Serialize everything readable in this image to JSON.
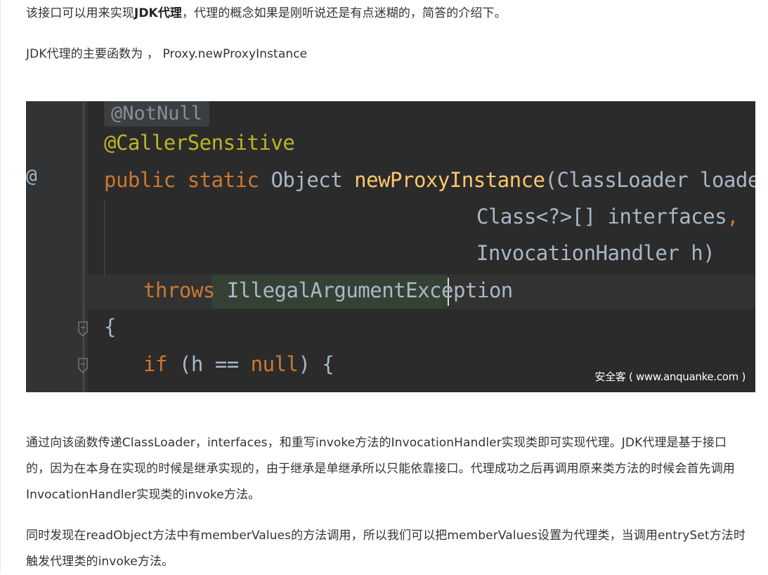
{
  "intro": {
    "line1_before": "该接口可以用来实现",
    "line1_bold": "JDK代理",
    "line1_after": "，代理的概念如果是刚听说还是有点迷糊的，简答的介绍下。",
    "line2": "JDK代理的主要函数为 ， Proxy.newProxyInstance"
  },
  "code": {
    "annotation_hint": "@NotNull",
    "gutter_marker": "@",
    "line1": "@CallerSensitive",
    "line2_kw": "public static ",
    "line2_type": "Object ",
    "line2_fn": "newProxyInstance",
    "line2_args": "(ClassLoader loader",
    "comma": ",",
    "line3": "Class<?>[] interfaces",
    "line4": "InvocationHandler h)",
    "line5_kw": "throws ",
    "line5_ex": "IllegalArgumentException",
    "line6": "{",
    "line7_kw": "if ",
    "line7_a": "(h == ",
    "line7_null": "null",
    "line7_b": ") {",
    "watermark": "安全客 ( www.anquanke.com )"
  },
  "body": {
    "para1": "通过向该函数传递ClassLoader，interfaces，和重写invoke方法的InvocationHandler实现类即可实现代理。JDK代理是基于接口的，因为在本身在实现的时候是继承实现的，由于继承是单继承所以只能依靠接口。代理成功之后再调用原来类方法的时候会首先调用InvocationHandler实现类的invoke方法。",
    "para2": "同时发现在readObject方法中有memberValues的方法调用，所以我们可以把memberValues设置为代理类，当调用entrySet方法时触发代理类的invoke方法。"
  },
  "colors": {
    "code_bg": "#2b2b2b",
    "keyword": "#cc7832",
    "function": "#ffc66d",
    "annotation": "#bbb529",
    "text": "#a9b7c6"
  }
}
